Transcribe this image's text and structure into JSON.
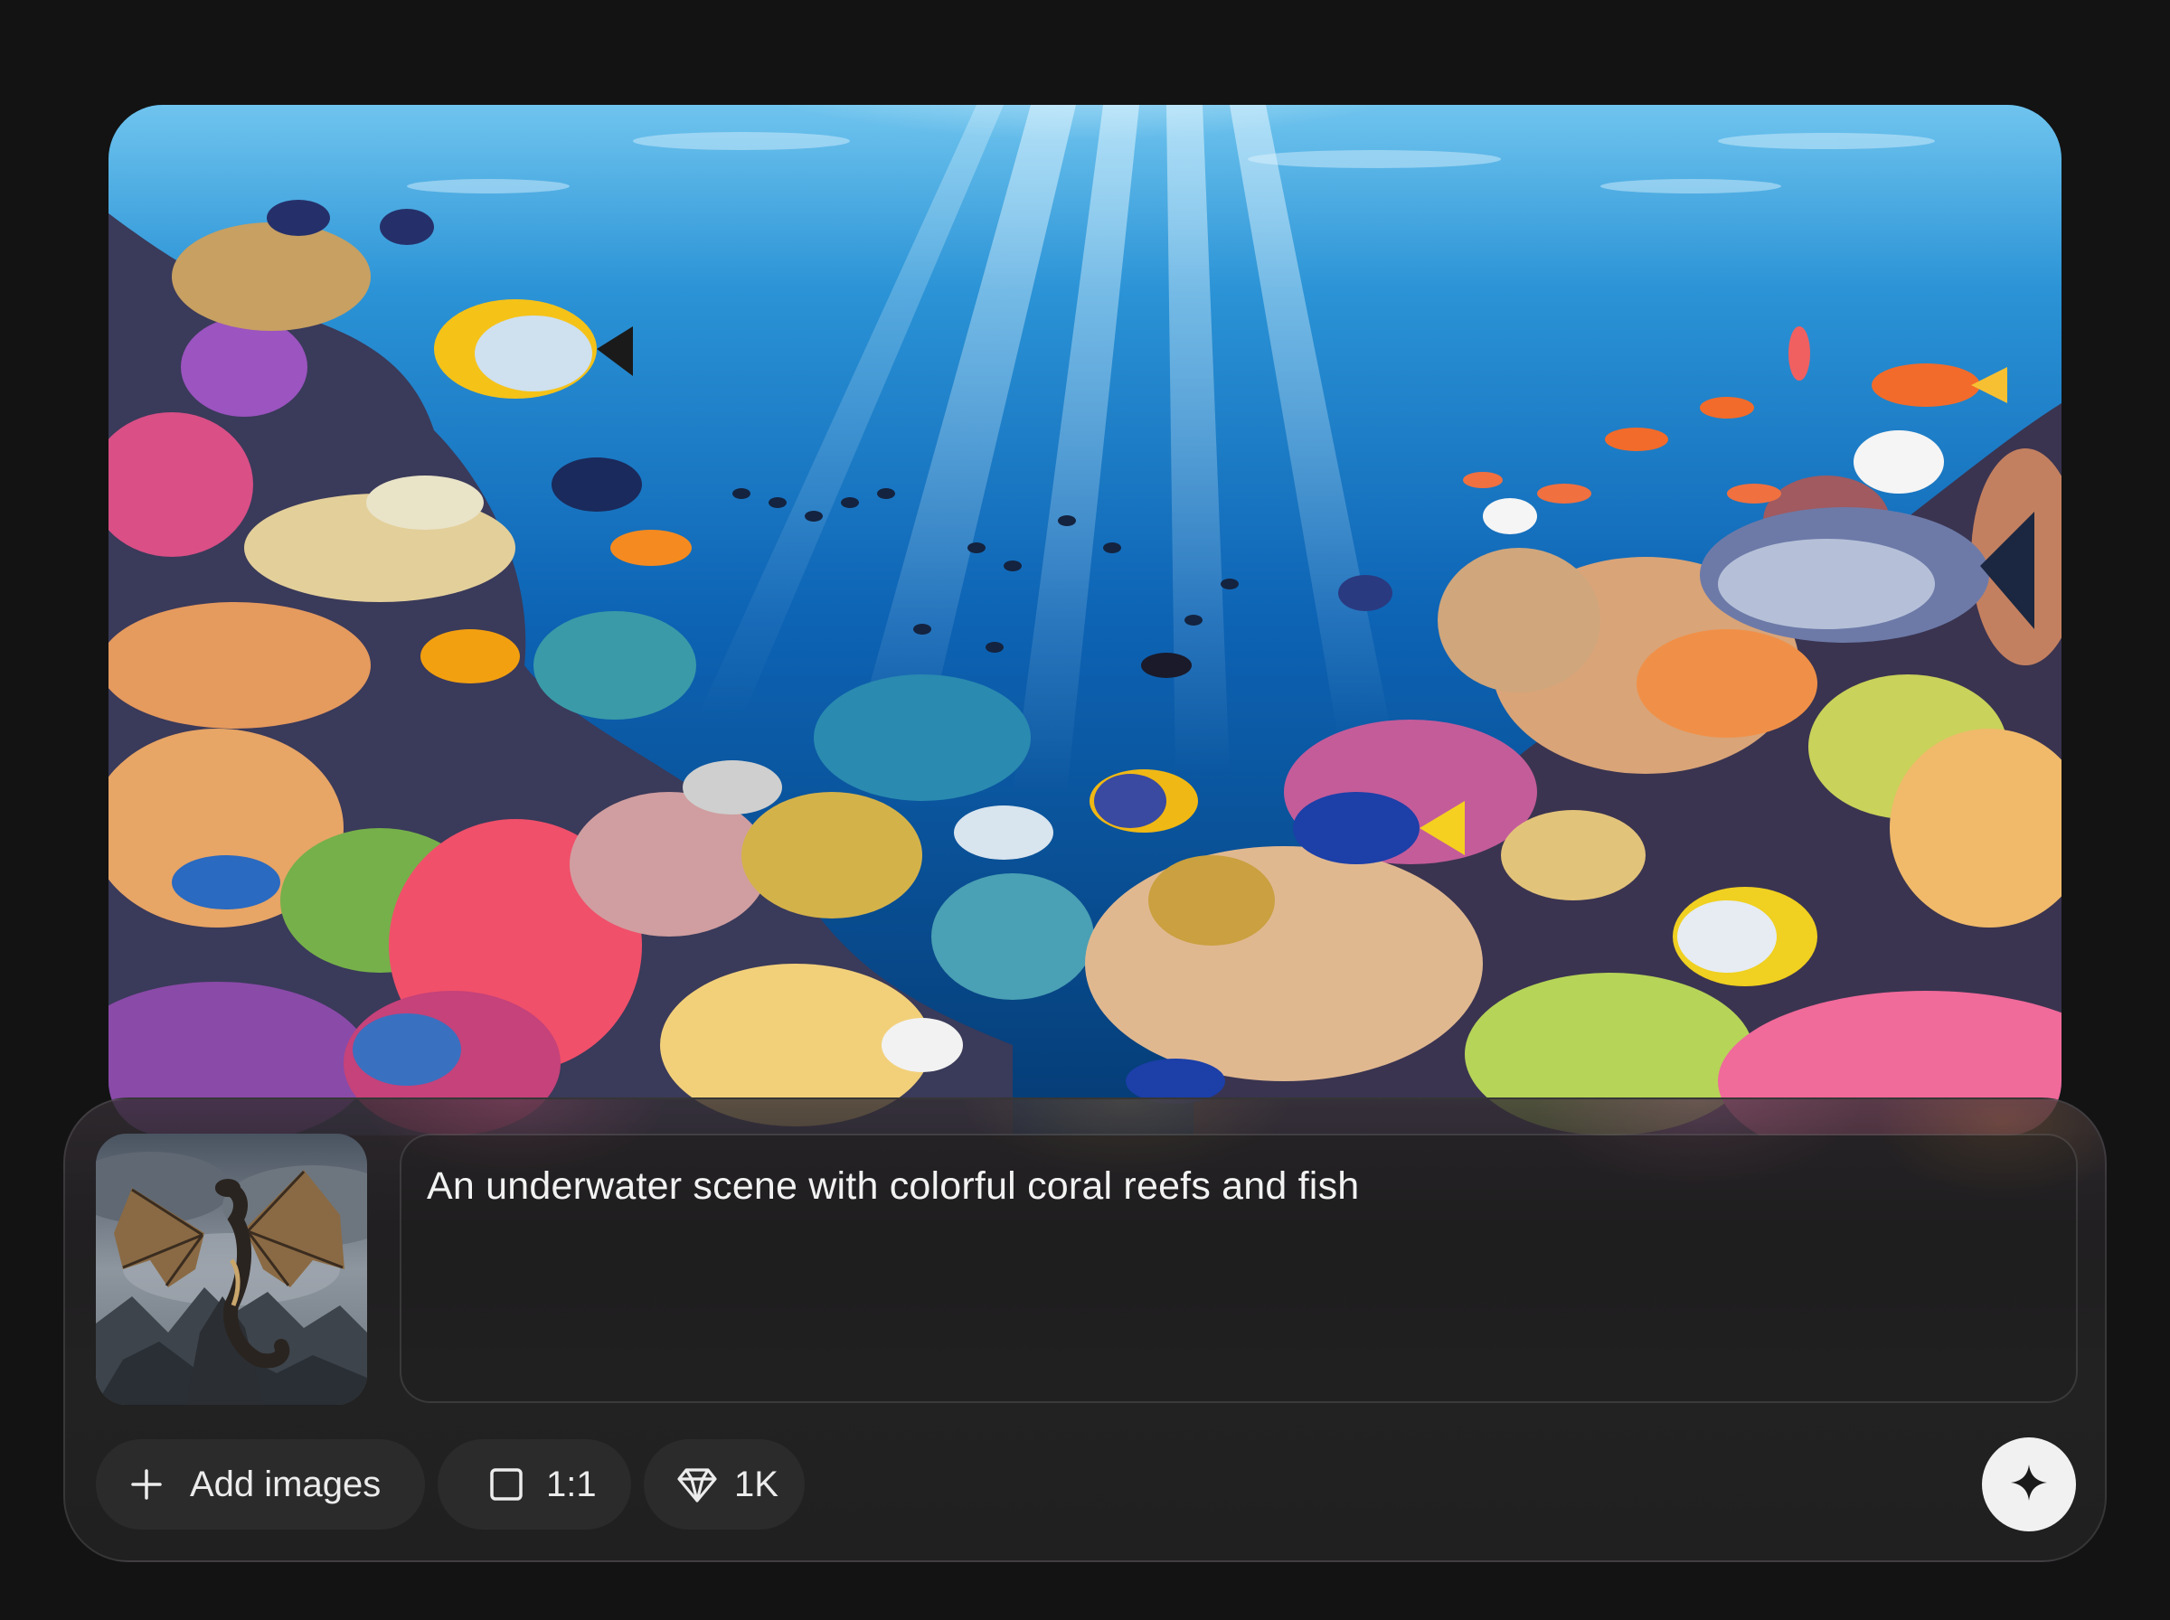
{
  "result_image": {
    "kind": "image",
    "subject": "underwater-coral-reef"
  },
  "composer": {
    "reference_image": {
      "kind": "image",
      "subject": "dragon-on-mountain"
    },
    "prompt": {
      "text": "An underwater scene with colorful coral reefs and fish"
    },
    "add_images": {
      "label": "Add images",
      "icon": "plus-icon"
    },
    "aspect_ratio": {
      "label": "1:1",
      "icon": "square-icon"
    },
    "quality": {
      "label": "1K",
      "icon": "diamond-icon"
    },
    "generate": {
      "icon": "sparkle-icon"
    }
  },
  "colors": {
    "background": "#131313",
    "panel": "#222222",
    "chip": "#2b2b2b",
    "text": "#f2f2f2",
    "generate_button": "#f1f1f1"
  }
}
